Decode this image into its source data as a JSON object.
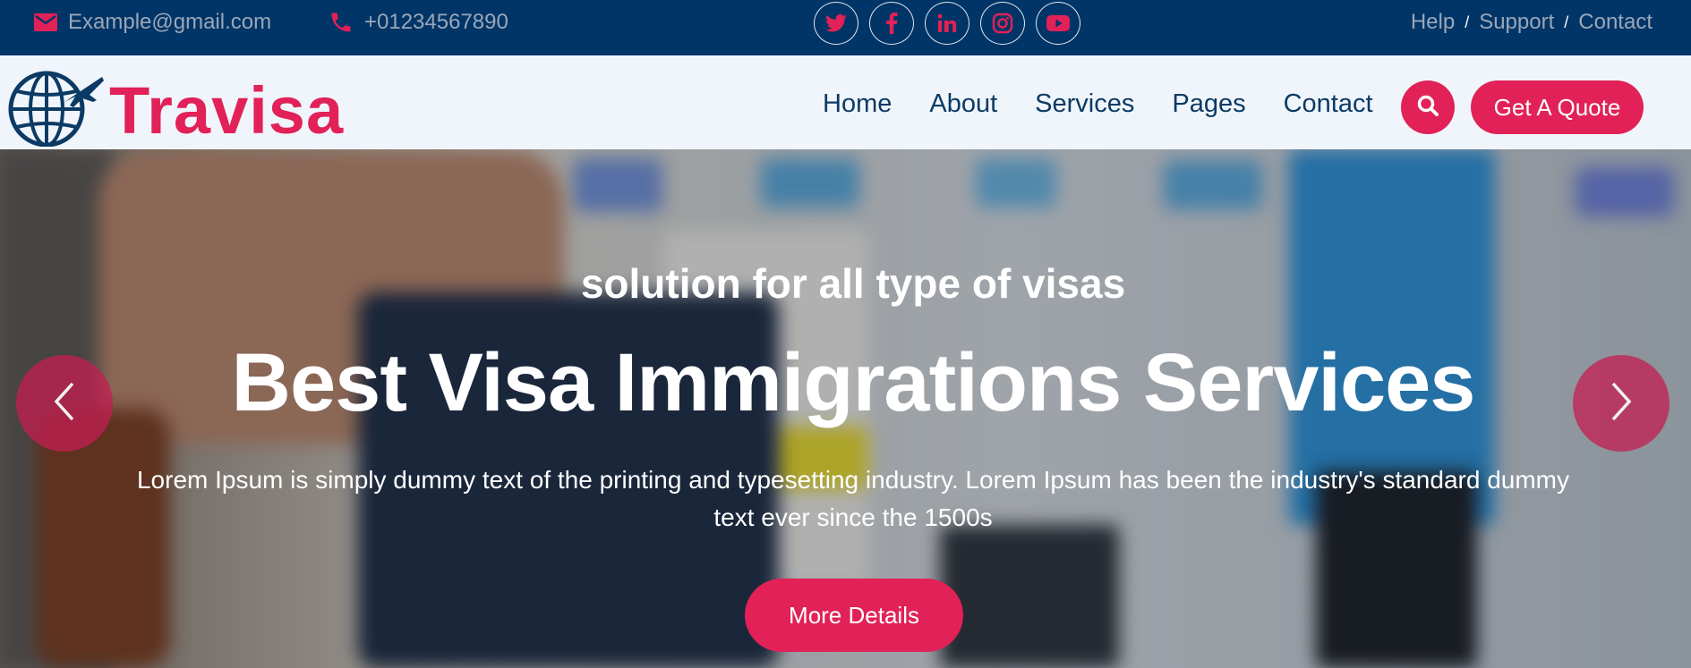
{
  "colors": {
    "topbar_bg": "#013567",
    "navbar_bg": "#f0f5fb",
    "accent": "#e12157",
    "nav_text": "#0b3a64",
    "topbar_text": "#9aa7b8"
  },
  "topbar": {
    "email": "Example@gmail.com",
    "email_icon": "envelope-icon",
    "phone": "+01234567890",
    "phone_icon": "phone-icon",
    "socials": [
      "twitter-icon",
      "facebook-icon",
      "linkedin-icon",
      "instagram-icon",
      "youtube-icon"
    ],
    "links": [
      "Help",
      "Support",
      "Contact"
    ],
    "separator": "/"
  },
  "navbar": {
    "brand": "Travisa",
    "brand_icon": "globe-plane-logo-icon",
    "menu": [
      "Home",
      "About",
      "Services",
      "Pages",
      "Contact"
    ],
    "search_icon": "search-icon",
    "quote_label": "Get A Quote"
  },
  "hero": {
    "subtitle": "solution for all type of visas",
    "title": "Best Visa Immigrations Services",
    "description": "Lorem Ipsum is simply dummy text of the printing and typesetting industry. Lorem Ipsum has been the industry's standard dummy text ever since the 1500s",
    "button_label": "More Details",
    "prev_icon": "chevron-left-icon",
    "next_icon": "chevron-right-icon"
  }
}
